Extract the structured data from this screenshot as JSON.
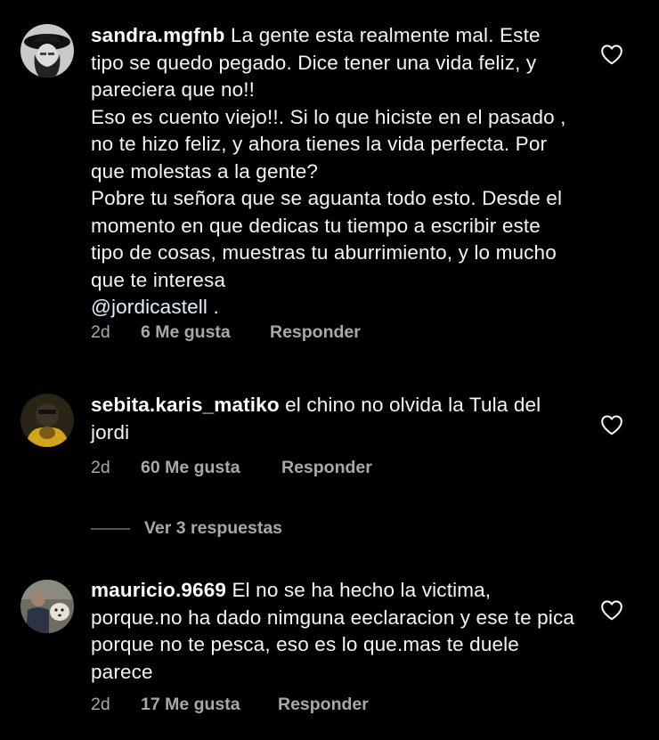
{
  "comments": [
    {
      "username": "sandra.mgfnb",
      "paragraphs": [
        "La gente esta realmente mal. Este tipo se quedo pegado. Dice tener una vida feliz, y pareciera que no!!",
        "Eso es cuento viejo!!. Si lo que hiciste en el pasado , no te hizo feliz, y ahora tienes la vida perfecta. Por que molestas a la gente?",
        "Pobre tu señora que se aguanta todo esto. Desde el momento en que dedicas tu tiempo a escribir este tipo de cosas, muestras tu aburrimiento, y lo mucho que te  interesa"
      ],
      "mention": "@jordicastell",
      "mention_suffix": " .",
      "time": "2d",
      "likes": "6 Me gusta",
      "reply": "Responder"
    },
    {
      "username": "sebita.karis_matiko",
      "text": "el chino no olvida la Tula del jordi",
      "time": "2d",
      "likes": "60 Me gusta",
      "reply": "Responder"
    },
    {
      "username": "mauricio.9669",
      "text": "El no se  ha hecho la victima, porque.no ha dado nimguna eeclaracion y ese te pica porque no te pesca, eso es lo que.mas te duele parece",
      "time": "2d",
      "likes": "17 Me gusta",
      "reply": "Responder"
    }
  ],
  "view_replies": "Ver 3 respuestas",
  "icons": {
    "like": "heart-outline-icon"
  },
  "colors": {
    "background": "#000000",
    "text": "#f5f5f5",
    "secondary": "#a8a8a8"
  }
}
